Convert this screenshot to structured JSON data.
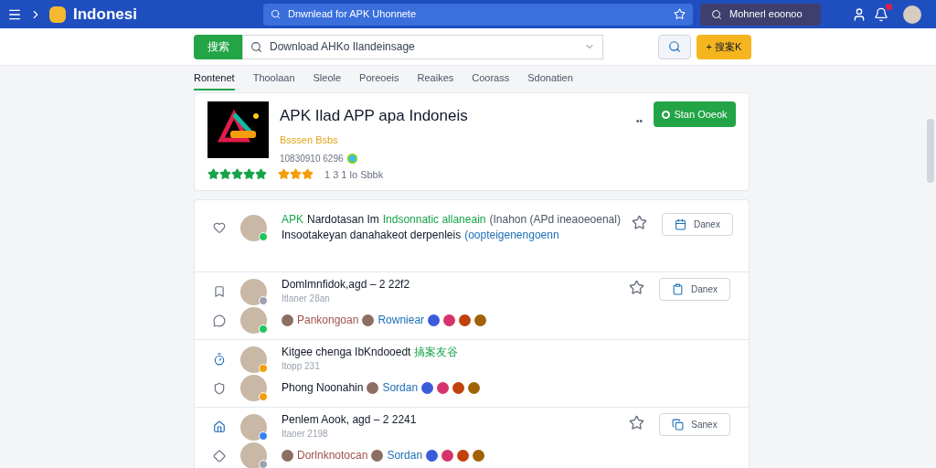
{
  "header": {
    "logo": "Indonesi",
    "search": {
      "value": "Dnwnlead for APK Uhonnete"
    },
    "account_button": "Mohnerl eoonoo",
    "notification": true
  },
  "toolbar": {
    "category_button": "搜索",
    "search": {
      "placeholder": "Download AHKo Ilandeinsage"
    },
    "add_button": "+ 搜案K"
  },
  "tabs": [
    {
      "label": "Rontenet",
      "selected": true
    },
    {
      "label": "Thoolaan",
      "selected": false
    },
    {
      "label": "Sleole",
      "selected": false
    },
    {
      "label": "Poreoeis",
      "selected": false
    },
    {
      "label": "Reaikes",
      "selected": false
    },
    {
      "label": "Coorass",
      "selected": false
    },
    {
      "label": "Sdonatien",
      "selected": false
    }
  ],
  "app_card": {
    "title": "APK Ilad APP apa Indoneis",
    "subtitle": "Bsssen Bsbs",
    "meta": "10830910 6296",
    "ratings": [
      {
        "stars": 5,
        "color": "#16a34a"
      },
      {
        "stars": 3,
        "color": "#f59e0b"
      }
    ],
    "rating_text": "1 3 1 lo Sbbk",
    "menu": "••",
    "open_button": "Stan Ooeok"
  },
  "feed": [
    {
      "lines": [
        {
          "color": "#22c55e",
          "parts": [
            {
              "kind": "accent",
              "text": "APK"
            },
            {
              "kind": "plain",
              "text": "Nardotasan Im"
            },
            {
              "kind": "accent",
              "text": "Indsonnatic allaneain"
            },
            {
              "kind": "muted",
              "text": "(Inahon (APd ineaoeoenal)"
            }
          ],
          "second": [
            {
              "kind": "plain",
              "text": "Insootakeyan danahakeot derpenleis"
            },
            {
              "kind": "link",
              "text": "(oopteigenengoenn"
            }
          ]
        }
      ],
      "action": "Danex"
    },
    {
      "lines": [
        {
          "color": "#9ca3af",
          "parts": [
            {
              "kind": "plain",
              "text": "Domlmnfidok,agd – 2 22f2"
            }
          ],
          "meta": "Itlaner 28an"
        },
        {
          "color": "#22c55e",
          "tags": [
            {
              "text": "Pankongoan",
              "color": "#a0524a"
            },
            {
              "text": "Rowniear",
              "color": "#1d6fb8"
            }
          ]
        }
      ],
      "action": "Danex"
    },
    {
      "lines": [
        {
          "color": "#f59e0b",
          "parts": [
            {
              "kind": "plain",
              "text": "Kitgee chenga IbKndooedt"
            },
            {
              "kind": "accent",
              "text": "搞案友谷"
            }
          ],
          "meta": "Itopp 231"
        },
        {
          "color": "#f59e0b",
          "parts": [
            {
              "kind": "plain",
              "text": "Phong Noonahin"
            }
          ],
          "tags": [
            {
              "text": "Sordan",
              "color": "#1d6fb8"
            }
          ]
        }
      ]
    },
    {
      "lines": [
        {
          "color": "#3b82f6",
          "parts": [
            {
              "kind": "plain",
              "text": "Penlem Aook, agd – 2 2241"
            }
          ],
          "meta": "Itaoer 2198"
        },
        {
          "color": "#9ca3af",
          "tags": [
            {
              "text": "Dorlnknotocan",
              "color": "#a0524a"
            },
            {
              "text": "Sordan",
              "color": "#1d6fb8"
            }
          ]
        }
      ],
      "action": "Sanex"
    }
  ]
}
